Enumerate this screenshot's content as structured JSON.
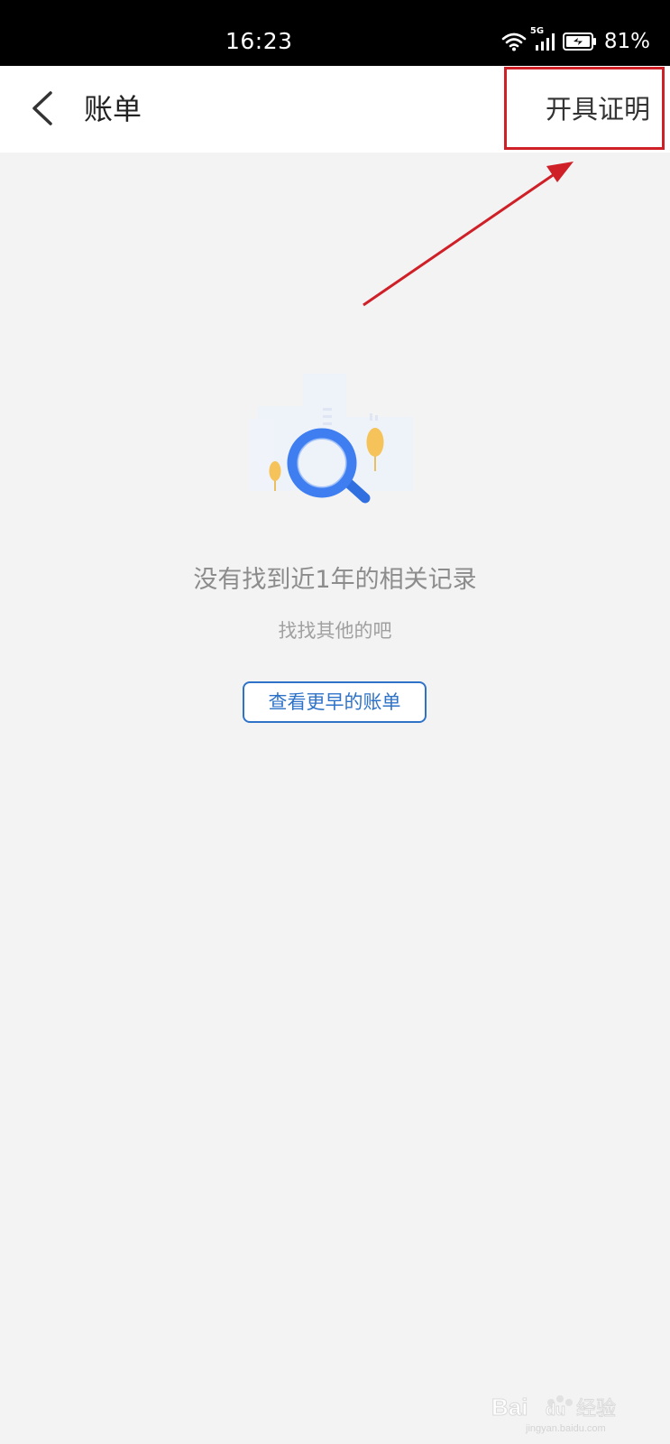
{
  "status_bar": {
    "time": "16:23",
    "network": "5G",
    "battery_percent": "81%"
  },
  "header": {
    "title": "账单",
    "action_label": "开具证明"
  },
  "empty_state": {
    "title": "没有找到近1年的相关记录",
    "subtitle": "找找其他的吧",
    "button_label": "查看更早的账单"
  },
  "watermark": {
    "text": "Baidu 经验",
    "url": "jingyan.baidu.com"
  },
  "colors": {
    "header_bg": "#ffffff",
    "page_bg": "#f3f3f3",
    "accent": "#2f73c9",
    "annotation": "#cf1f27"
  }
}
